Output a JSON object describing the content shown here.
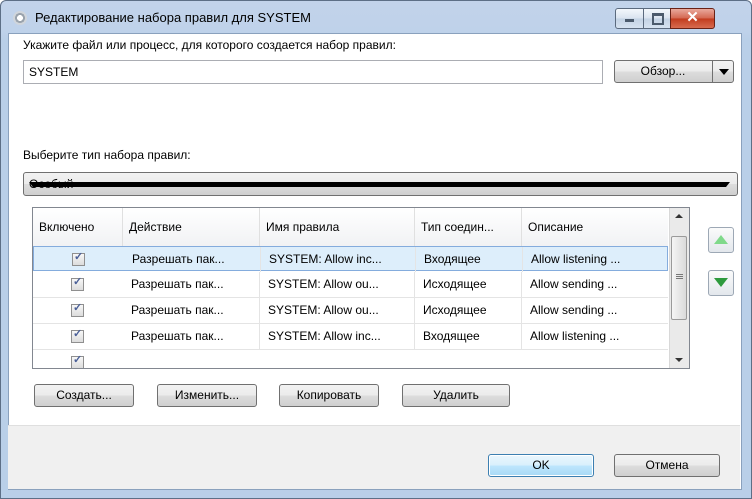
{
  "window": {
    "title": "Редактирование набора правил для SYSTEM",
    "close_glyph": "✕"
  },
  "file_section": {
    "label": "Укажите файл или процесс, для которого создается набор правил:",
    "value": "SYSTEM",
    "browse_label": "Обзор..."
  },
  "type_section": {
    "label": "Выберите тип набора правил:",
    "selected": "Особый"
  },
  "table": {
    "columns": [
      "Включено",
      "Действие",
      "Имя правила",
      "Тип соедин...",
      "Описание"
    ],
    "rows": [
      {
        "enabled": true,
        "action": "Разрешать пак...",
        "name": "SYSTEM: Allow inc...",
        "type": "Входящее",
        "description": "Allow listening ..."
      },
      {
        "enabled": true,
        "action": "Разрешать пак...",
        "name": "SYSTEM: Allow ou...",
        "type": "Исходящее",
        "description": "Allow sending ..."
      },
      {
        "enabled": true,
        "action": "Разрешать пак...",
        "name": "SYSTEM: Allow ou...",
        "type": "Исходящее",
        "description": "Allow sending ..."
      },
      {
        "enabled": true,
        "action": "Разрешать пак...",
        "name": "SYSTEM: Allow inc...",
        "type": "Входящее",
        "description": "Allow listening ..."
      }
    ]
  },
  "actions": {
    "create": "Создать...",
    "edit": "Изменить...",
    "copy": "Копировать",
    "delete": "Удалить"
  },
  "footer": {
    "ok": "OK",
    "cancel": "Отмена"
  },
  "colors": {
    "titlebar": "#bfd2ea",
    "close_button": "#c23b1d",
    "selected_row": "#ddeefb",
    "move_up_arrow": "#7fd98a",
    "move_down_arrow": "#2e9a3d"
  }
}
